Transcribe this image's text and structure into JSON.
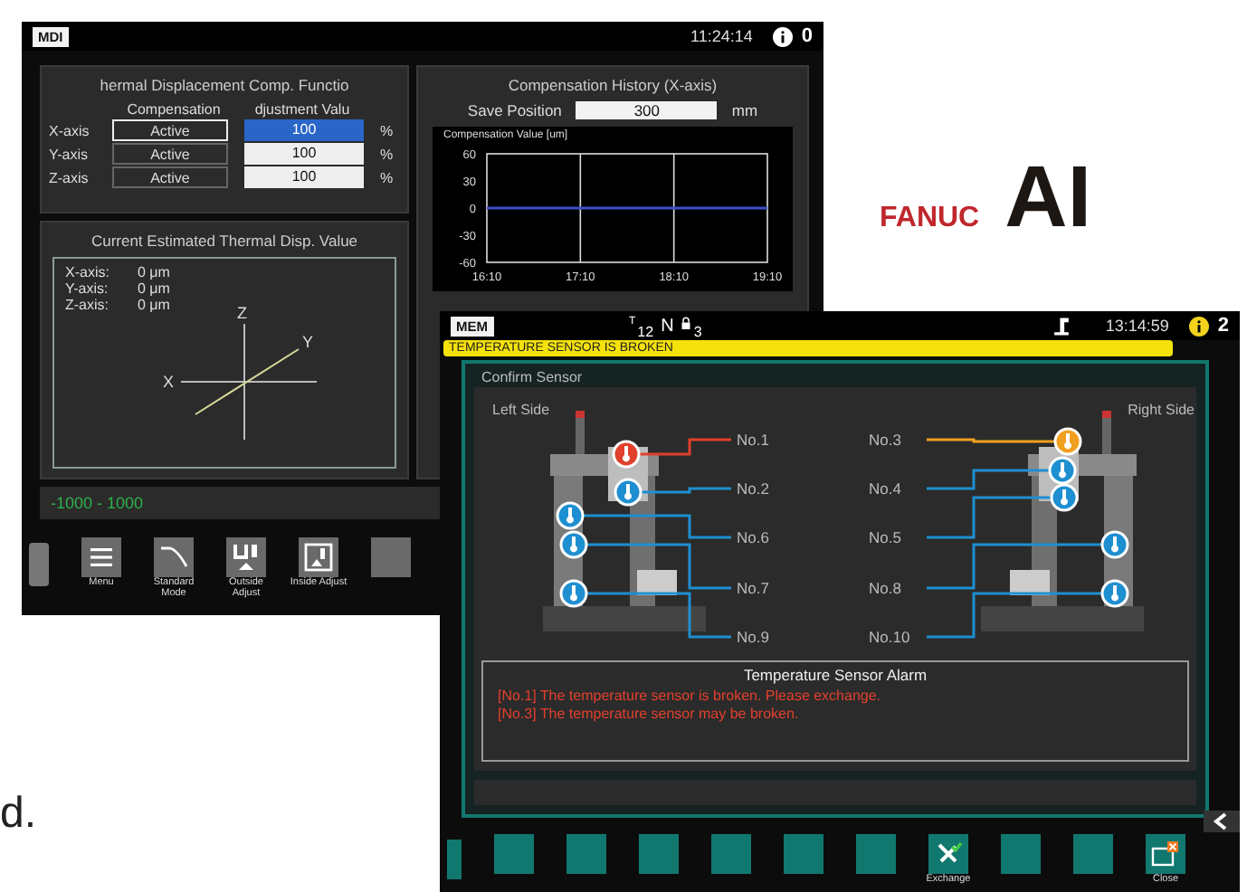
{
  "screen_left": {
    "mode": "MDI",
    "time": "11:24:14",
    "alarm_count": "0",
    "comp_panel": {
      "title": "hermal Displacement Comp. Functio",
      "headers": [
        "Compensation",
        "djustment Valu"
      ],
      "rows": [
        {
          "axis": "X-axis",
          "compensation": "Active",
          "value": "100",
          "unit": "%",
          "selected": true
        },
        {
          "axis": "Y-axis",
          "compensation": "Active",
          "value": "100",
          "unit": "%",
          "selected": false
        },
        {
          "axis": "Z-axis",
          "compensation": "Active",
          "value": "100",
          "unit": "%",
          "selected": false
        }
      ]
    },
    "history_panel": {
      "title": "Compensation History (X-axis)",
      "save_label": "Save Position",
      "save_value": "300",
      "save_unit": "mm",
      "chart_data": {
        "type": "line",
        "ylabel": "Compensation Value [um]",
        "x": [
          "16:10",
          "17:10",
          "18:10",
          "19:10"
        ],
        "ylim": [
          -60,
          60
        ],
        "yticks": [
          60,
          30,
          0,
          -30,
          -60
        ],
        "series": [
          {
            "color": "#3a4fc8",
            "values": [
              0,
              0,
              0,
              0
            ]
          }
        ]
      }
    },
    "estimate_panel": {
      "title": "Current Estimated Thermal Disp. Value",
      "rows": [
        {
          "axis": "X-axis:",
          "value": "0 μm"
        },
        {
          "axis": "Y-axis:",
          "value": "0 μm"
        },
        {
          "axis": "Z-axis:",
          "value": "0 μm"
        }
      ],
      "axis_labels": {
        "z": "Z",
        "y": "Y",
        "x": "X"
      }
    },
    "range": "-1000 - 1000",
    "softkeys": [
      {
        "kind": "menu",
        "label": "Menu"
      },
      {
        "kind": "curve",
        "label": "Standard Mode"
      },
      {
        "kind": "outside",
        "label": "Outside Adjust"
      },
      {
        "kind": "inside",
        "label": "Inside Adjust"
      },
      {
        "kind": "blank"
      }
    ]
  },
  "screen_right": {
    "mode": "MEM",
    "tool_label": "T",
    "tool_number": "12",
    "n_label": "N",
    "lock_number": "3",
    "time": "13:14:59",
    "alarm_count": "2",
    "alarm_message": "TEMPERATURE SENSOR IS BROKEN",
    "panel_title": "Confirm Sensor",
    "left_side": "Left Side",
    "right_side": "Right Side",
    "left_sensors": [
      {
        "label": "No.1",
        "color": "#e0402c"
      },
      {
        "label": "No.2",
        "color": "#1e8fd0"
      },
      {
        "label": "No.6",
        "color": "#1e8fd0"
      },
      {
        "label": "No.7",
        "color": "#1e8fd0"
      },
      {
        "label": "No.9",
        "color": "#1e8fd0"
      }
    ],
    "right_sensors": [
      {
        "label": "No.3",
        "color": "#f0a020"
      },
      {
        "label": "No.4",
        "color": "#1e8fd0"
      },
      {
        "label": "No.5",
        "color": "#1e8fd0"
      },
      {
        "label": "No.8",
        "color": "#1e8fd0"
      },
      {
        "label": "No.10",
        "color": "#1e8fd0"
      }
    ],
    "alarm_box": {
      "title": "Temperature Sensor Alarm",
      "lines": [
        "[No.1] The temperature sensor is broken. Please exchange.",
        "[No.3] The temperature sensor may be broken."
      ]
    },
    "softkeys": [
      {
        "kind": "blank"
      },
      {
        "kind": "blank"
      },
      {
        "kind": "blank"
      },
      {
        "kind": "blank"
      },
      {
        "kind": "blank"
      },
      {
        "kind": "blank"
      },
      {
        "kind": "exchange",
        "label": "Exchange"
      },
      {
        "kind": "blank"
      },
      {
        "kind": "blank"
      },
      {
        "kind": "close",
        "label": "Close"
      }
    ]
  },
  "logo": {
    "brand": "FANUC",
    "mark": "AI"
  },
  "caption": "d."
}
